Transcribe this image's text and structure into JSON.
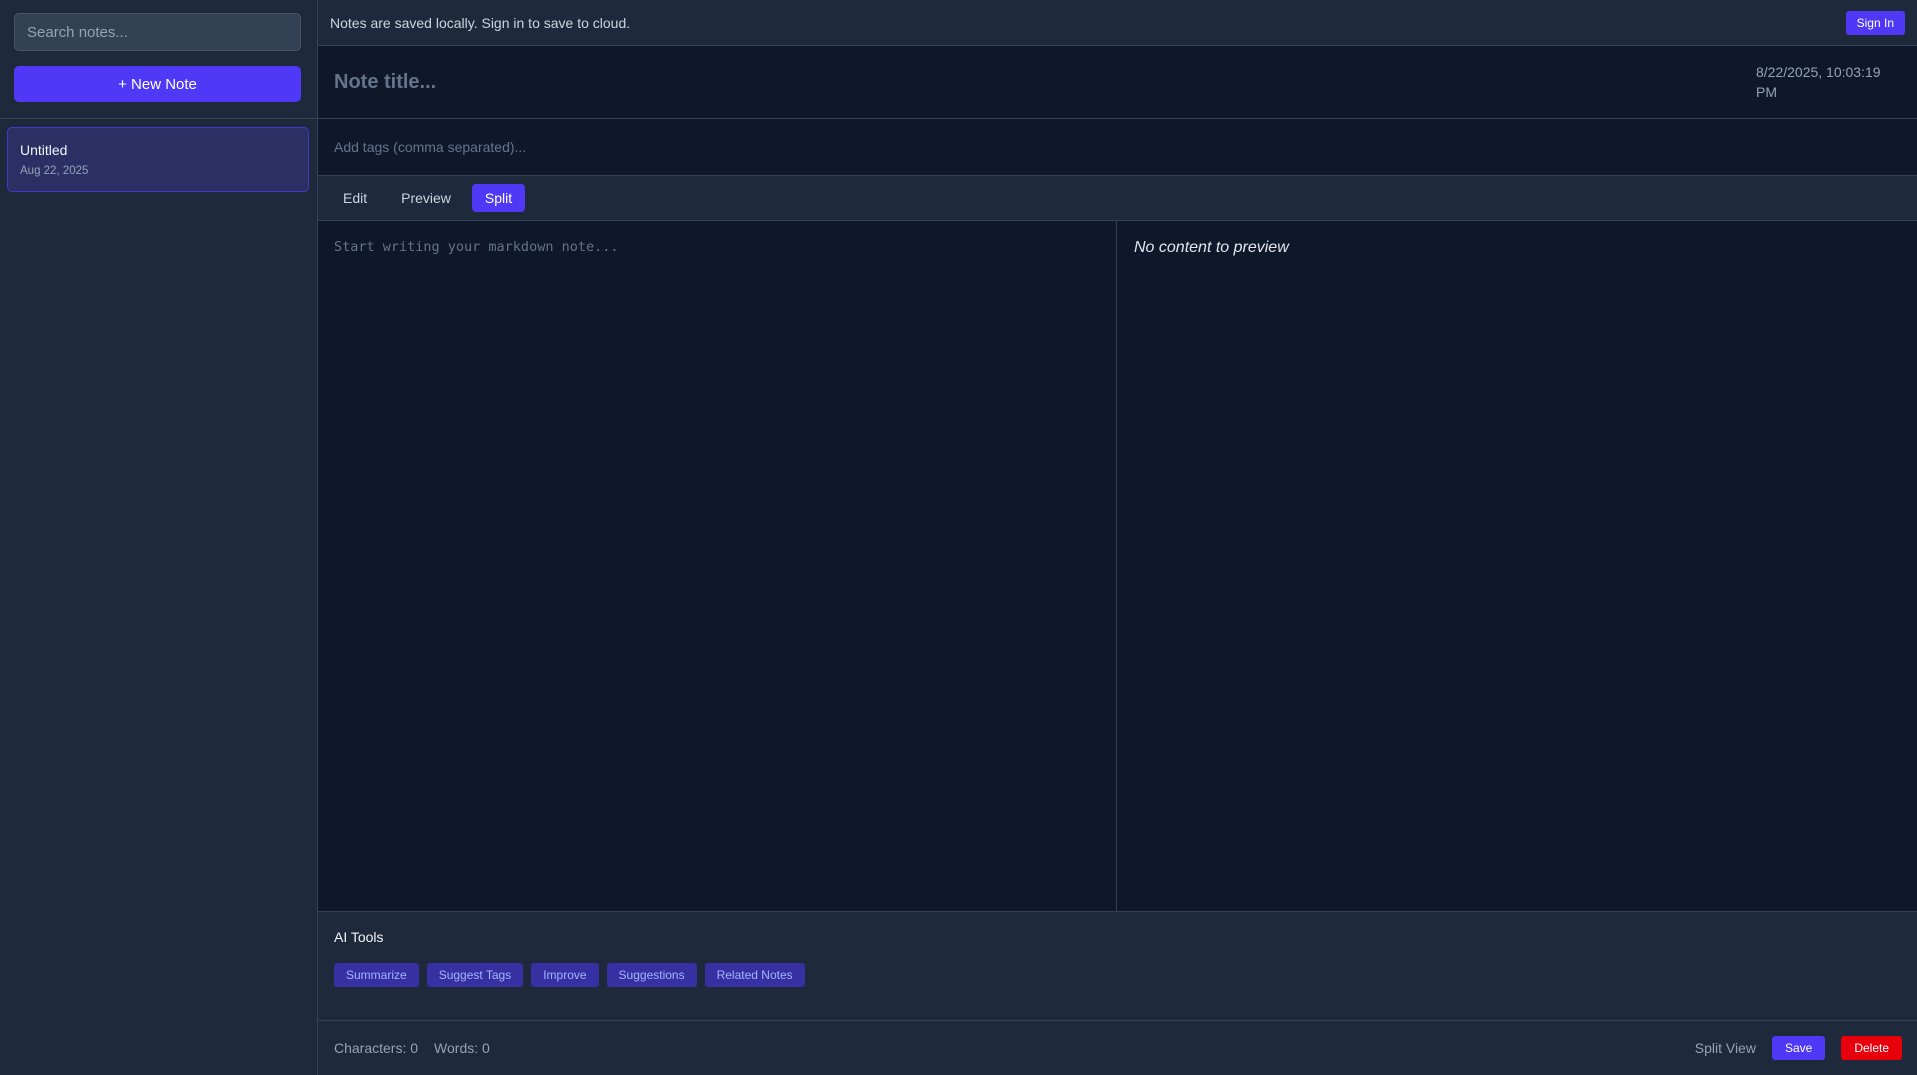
{
  "sidebar": {
    "search_placeholder": "Search notes...",
    "new_note_label": "+ New Note",
    "notes": [
      {
        "title": "Untitled",
        "date": "Aug 22, 2025"
      }
    ]
  },
  "topbar": {
    "message": "Notes are saved locally. Sign in to save to cloud.",
    "signin_label": "Sign In"
  },
  "note": {
    "title_placeholder": "Note title...",
    "timestamp": "8/22/2025, 10:03:19 PM",
    "tags_placeholder": "Add tags (comma separated)...",
    "body_placeholder": "Start writing your markdown note..."
  },
  "modes": {
    "edit": "Edit",
    "preview": "Preview",
    "split": "Split",
    "active": "split"
  },
  "preview": {
    "empty_text": "No content to preview"
  },
  "ai_tools": {
    "title": "AI Tools",
    "buttons": [
      "Summarize",
      "Suggest Tags",
      "Improve",
      "Suggestions",
      "Related Notes"
    ]
  },
  "status": {
    "characters": "Characters: 0",
    "words": "Words: 0",
    "view_mode": "Split View",
    "save_label": "Save",
    "delete_label": "Delete"
  },
  "colors": {
    "accent": "#4f39f6",
    "danger": "#e7000b",
    "background": "#0f172a",
    "panel": "#1e293b"
  }
}
